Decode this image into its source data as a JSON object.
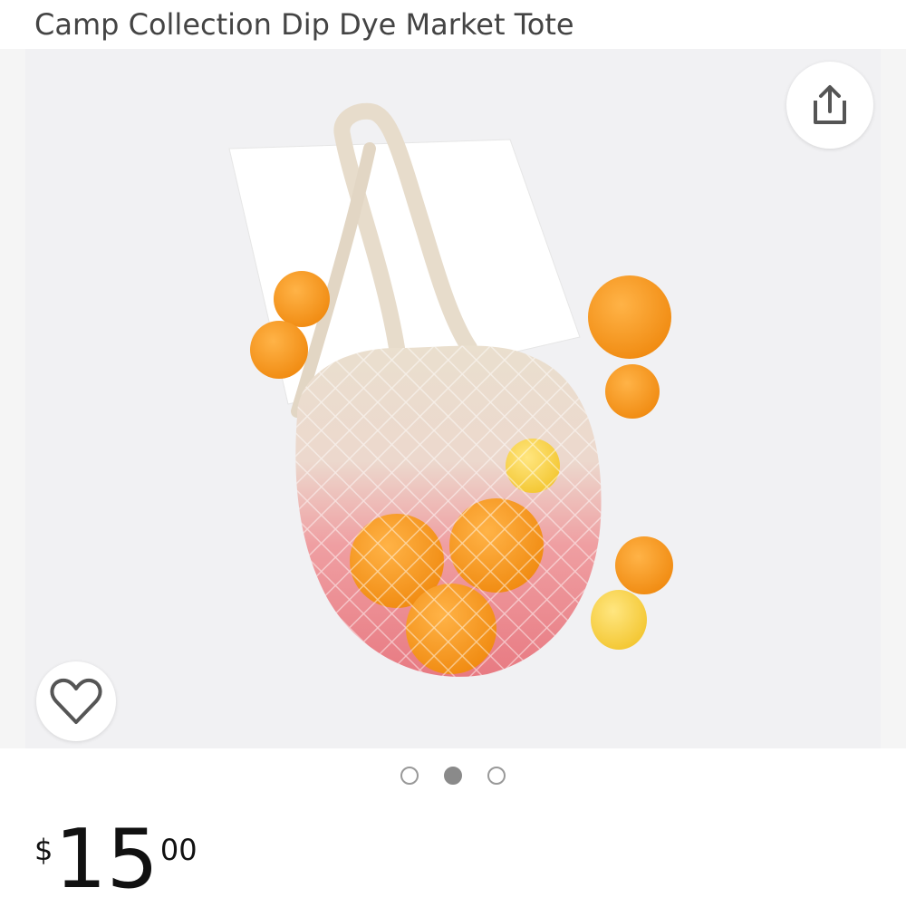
{
  "product": {
    "title": "Camp Collection Dip Dye Market Tote"
  },
  "gallery": {
    "image_description": "Cotton mesh market tote with pink dip-dye bottom holding oranges and lemons",
    "share_icon": "share-icon",
    "wishlist_icon": "heart-outline-icon",
    "pages": 3,
    "active_page": 2
  },
  "price": {
    "symbol": "$",
    "whole": "15",
    "fraction": "00"
  },
  "colors": {
    "title_text": "#444444",
    "dot_active": "#8a8a8a",
    "icon_stroke": "#555555"
  }
}
